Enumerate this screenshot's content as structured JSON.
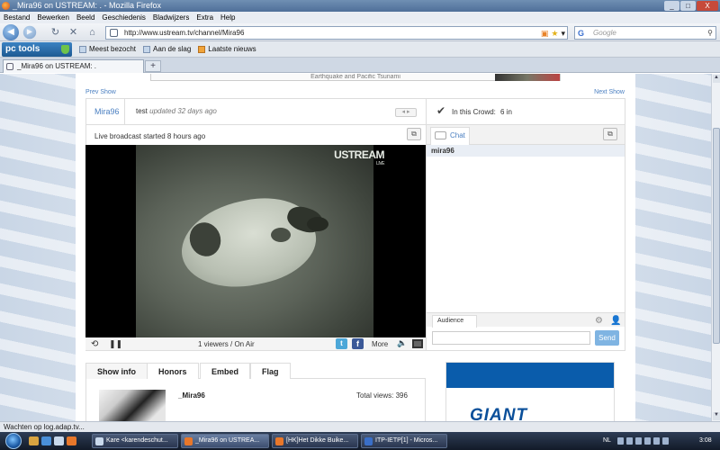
{
  "window": {
    "title": "_Mira96 on USTREAM: . - Mozilla Firefox",
    "controls": [
      "_",
      "□",
      "X"
    ]
  },
  "menu": [
    "Bestand",
    "Bewerken",
    "Beeld",
    "Geschiedenis",
    "Bladwijzers",
    "Extra",
    "Help"
  ],
  "nav": {
    "url": "http://www.ustream.tv/channel/Mira96",
    "search_placeholder": "Google"
  },
  "bookmarks": {
    "toolbar_brand": "pc tools",
    "items": [
      "Meest bezocht",
      "Aan de slag",
      "Laatste nieuws"
    ]
  },
  "tabs": [
    {
      "label": "_Mira96 on USTREAM: ."
    }
  ],
  "page": {
    "banner_text": "Earthquake and Pacific Tsunami",
    "prev_show": "Prev Show",
    "next_show": "Next Show",
    "channel": {
      "name": "Mira96",
      "title": "test",
      "updated": "updated 32 days ago",
      "pager": "◂ ▸"
    },
    "crowd": {
      "label": "In this Crowd:",
      "count": "6 in"
    },
    "player": {
      "broadcast_status": "Live broadcast started 8 hours ago",
      "watermark": "USTREAM",
      "watermark_sub": "LIVE",
      "viewers": "1 viewers / On Air",
      "more_label": "More",
      "twitter_label": "t",
      "facebook_label": "f"
    },
    "chat": {
      "tab_label": "Chat",
      "user": "mira96",
      "audience_tab": "Audience",
      "send_label": "Send"
    },
    "info": {
      "tabs": [
        "Show info",
        "Honors",
        "Embed",
        "Flag"
      ],
      "name": "_Mira96",
      "total_views": "Total views: 396"
    },
    "ad": {
      "brand": "GIANT",
      "color": "#0a5cab"
    }
  },
  "status_text": "Wachten op log.adap.tv...",
  "taskbar": {
    "items": [
      {
        "label": "Kare <karendeschut..."
      },
      {
        "label": "_Mira96 on USTREA..."
      },
      {
        "label": "[HK]Het Dikke Buike..."
      },
      {
        "label": "ITP-IETP[1] - Micros..."
      }
    ],
    "language": "NL",
    "clock": "3:08"
  }
}
